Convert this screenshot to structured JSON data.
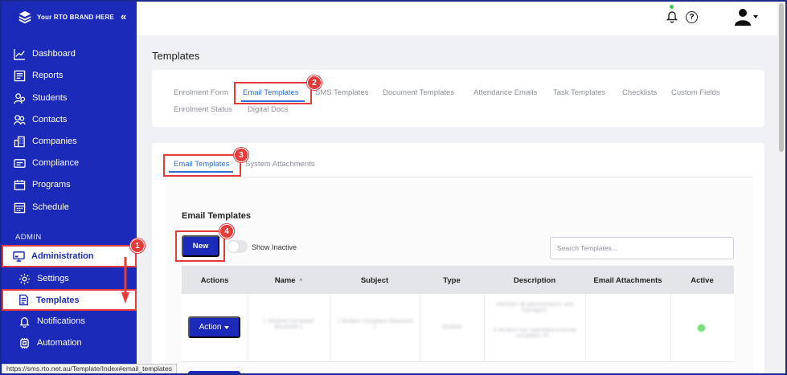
{
  "brand": {
    "text": "Your RTO BRAND HERE",
    "collapse": "«"
  },
  "sidebar": {
    "items": [
      {
        "label": "Dashboard",
        "icon": "chart-line-icon"
      },
      {
        "label": "Reports",
        "icon": "report-icon"
      },
      {
        "label": "Students",
        "icon": "students-icon"
      },
      {
        "label": "Contacts",
        "icon": "contacts-icon"
      },
      {
        "label": "Companies",
        "icon": "building-icon"
      },
      {
        "label": "Compliance",
        "icon": "id-card-icon"
      },
      {
        "label": "Programs",
        "icon": "programs-icon"
      },
      {
        "label": "Schedule",
        "icon": "calendar-icon"
      }
    ],
    "section": "ADMIN",
    "admin_items": [
      {
        "label": "Administration",
        "icon": "monitor-icon"
      },
      {
        "label": "Settings",
        "icon": "gear-icon"
      },
      {
        "label": "Templates",
        "icon": "document-icon"
      },
      {
        "label": "Notifications",
        "icon": "bell-icon"
      },
      {
        "label": "Automation",
        "icon": "automation-icon"
      }
    ]
  },
  "status_bar": {
    "url": "https://sms.rto.net.au/Template/Index#email_templates"
  },
  "page": {
    "title": "Templates"
  },
  "tabs": [
    "Enrolment Form",
    "Email Templates",
    "SMS Templates",
    "Document Templates",
    "Attendance Emails",
    "Task Templates",
    "Checklists",
    "Custom Fields",
    "Enrolment Status",
    "Digital Docs"
  ],
  "subtabs": [
    "Email Templates",
    "System Attachments"
  ],
  "markers": [
    "1",
    "2",
    "3",
    "4"
  ],
  "section": {
    "title": "Email Templates",
    "new_label": "New",
    "show_inactive": "Show Inactive",
    "search_placeholder": "Search Templates..."
  },
  "table": {
    "headers": [
      "Actions",
      "Name",
      "Subject",
      "Type",
      "Description",
      "Email Attachments",
      "Active"
    ],
    "sort_indicator": "^",
    "rows": [
      {
        "action": "Action",
        "name": "1 Student Complaint Received 1",
        "subject": "1 Student Complaint Received 1",
        "type": "Student",
        "description": [
          "Attention all administrators and managers,",
          "A Student has submitted a formal complaint. Pl..."
        ],
        "attachments": "",
        "active": true
      }
    ]
  },
  "colors": {
    "sidebar": "#1b2ab8",
    "accent": "#2c6fd9",
    "highlight": "#e53b3b",
    "active": "#7be07b"
  }
}
